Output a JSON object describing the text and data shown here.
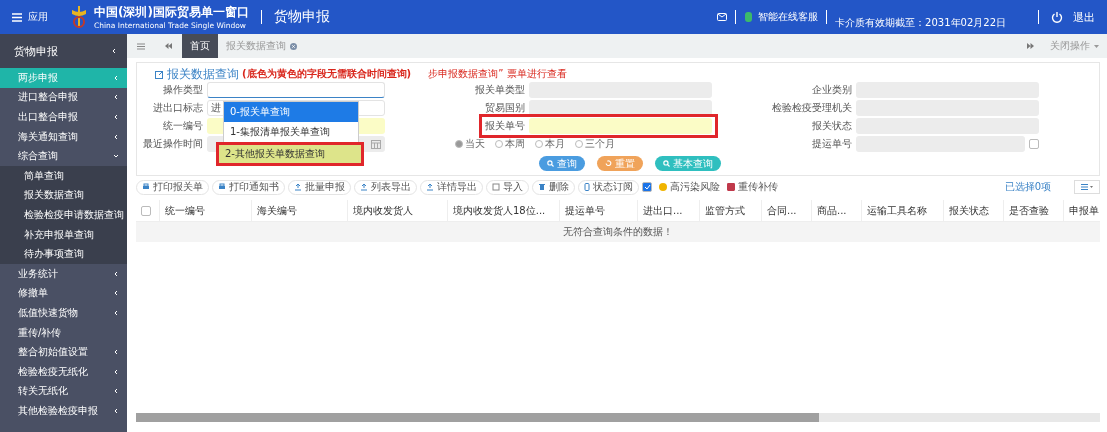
{
  "header": {
    "menu_label": "应用",
    "site_title": "中国(深圳)国际贸易单一窗口",
    "site_subtitle": "China International Trade Single Window",
    "module_title": "货物申报",
    "service_label": "智能在线客服",
    "card_expiry": "卡介质有效期截至：2031年02月22日",
    "logout_label": "退出"
  },
  "sidebar": {
    "title": "货物申报",
    "items": [
      {
        "label": "两步申报",
        "kind": "group",
        "selected": true,
        "expanded": false
      },
      {
        "label": "进口整合申报",
        "kind": "group",
        "selected": false,
        "expanded": false
      },
      {
        "label": "出口整合申报",
        "kind": "group",
        "selected": false,
        "expanded": false
      },
      {
        "label": "海关通知查询",
        "kind": "group",
        "selected": false,
        "expanded": false
      },
      {
        "label": "综合查询",
        "kind": "group",
        "selected": false,
        "expanded": true,
        "children": [
          {
            "label": "简单查询",
            "selected": false
          },
          {
            "label": "报关数据查询",
            "selected": false
          },
          {
            "label": "检验检疫申请数据查询",
            "selected": false
          },
          {
            "label": "补充申报单查询",
            "selected": false
          },
          {
            "label": "待办事项查询",
            "selected": false
          }
        ]
      },
      {
        "label": "业务统计",
        "kind": "group",
        "selected": false,
        "expanded": false
      },
      {
        "label": "修撤单",
        "kind": "group",
        "selected": false,
        "expanded": false
      },
      {
        "label": "低值快速货物",
        "kind": "group",
        "selected": false,
        "expanded": false
      },
      {
        "label": "重传/补传",
        "kind": "link",
        "selected": false
      },
      {
        "label": "整合初始值设置",
        "kind": "group",
        "selected": false,
        "expanded": false
      },
      {
        "label": "检验检疫无纸化",
        "kind": "group",
        "selected": false,
        "expanded": false
      },
      {
        "label": "转关无纸化",
        "kind": "group",
        "selected": false,
        "expanded": false
      },
      {
        "label": "其他检验检疫申报",
        "kind": "group",
        "selected": false,
        "expanded": false
      }
    ]
  },
  "tabs": [
    {
      "label": "首页",
      "selected": true,
      "closable": false
    },
    {
      "label": "报关数据查询",
      "selected": false,
      "closable": true
    }
  ],
  "close_ops": "关闭操作",
  "form": {
    "title": "报关数据查询",
    "hint": "(底色为黄色的字段无需联合时间查询)",
    "notice": "步申报数据查询” 票单进行查看",
    "rows": [
      [
        {
          "label": "操作类型",
          "kind": "text",
          "focused": true,
          "marked": false
        },
        {
          "label": "报关单类型",
          "kind": "disabled",
          "marked": false
        },
        {
          "label": "企业类别",
          "kind": "disabled",
          "marked": false
        }
      ],
      [
        {
          "label": "进出口标志",
          "kind": "text",
          "value": "进",
          "focused": false,
          "marked": false
        },
        {
          "label": "贸易国别",
          "kind": "disabled",
          "marked": false
        },
        {
          "label": "检验检疫受理机关",
          "kind": "disabled",
          "marked": false
        }
      ],
      [
        {
          "label": "统一编号",
          "kind": "highlight",
          "marked": false
        },
        {
          "label": "报关单号",
          "kind": "highlight",
          "marked": true
        },
        {
          "label": "报关状态",
          "kind": "disabled",
          "marked": false
        }
      ],
      [
        {
          "label": "最近操作时间",
          "kind": "date",
          "marked": false
        },
        {
          "kind": "radios",
          "options": [
            {
              "label": "当天",
              "selected": true
            },
            {
              "label": "本周",
              "selected": false
            },
            {
              "label": "本月",
              "selected": false
            },
            {
              "label": "三个月",
              "selected": false
            }
          ]
        },
        {
          "label": "提运单号",
          "kind": "disabled",
          "marked": false,
          "checkbox": {
            "checked": false
          }
        }
      ]
    ],
    "dropdown": [
      {
        "label": "0-报关单查询",
        "selected": true,
        "marked": false
      },
      {
        "label": "1-集报清单报关单查询",
        "selected": false,
        "marked": false
      },
      {
        "label": "2-其他报关单数据查询",
        "selected": false,
        "marked": true
      }
    ],
    "buttons": [
      {
        "label": "查询",
        "kind": "search"
      },
      {
        "label": "重置",
        "kind": "reset"
      },
      {
        "label": "基本查询",
        "kind": "basic"
      }
    ]
  },
  "toolbar": {
    "buttons": [
      "打印报关单",
      "打印通知书",
      "批量申报",
      "列表导出",
      "详情导出",
      "导入",
      "删除",
      "状态订阅"
    ],
    "filter_checked": true,
    "legend": [
      {
        "label": "高污染风险",
        "kind": "dot",
        "color": "#f0b400"
      },
      {
        "label": "重传补传",
        "kind": "square",
        "color": "#c0394b"
      }
    ],
    "selected_count": "已选择0项"
  },
  "table": {
    "columns": [
      "统一编号",
      "海关编号",
      "境内收发货人",
      "境内收发货人18位...",
      "提运单号",
      "进出口...",
      "监管方式",
      "合同...",
      "商品...",
      "运输工具名称",
      "报关状态",
      "是否查验",
      "申报单"
    ],
    "select_all": false,
    "empty_message": "无符合查询条件的数据！"
  }
}
